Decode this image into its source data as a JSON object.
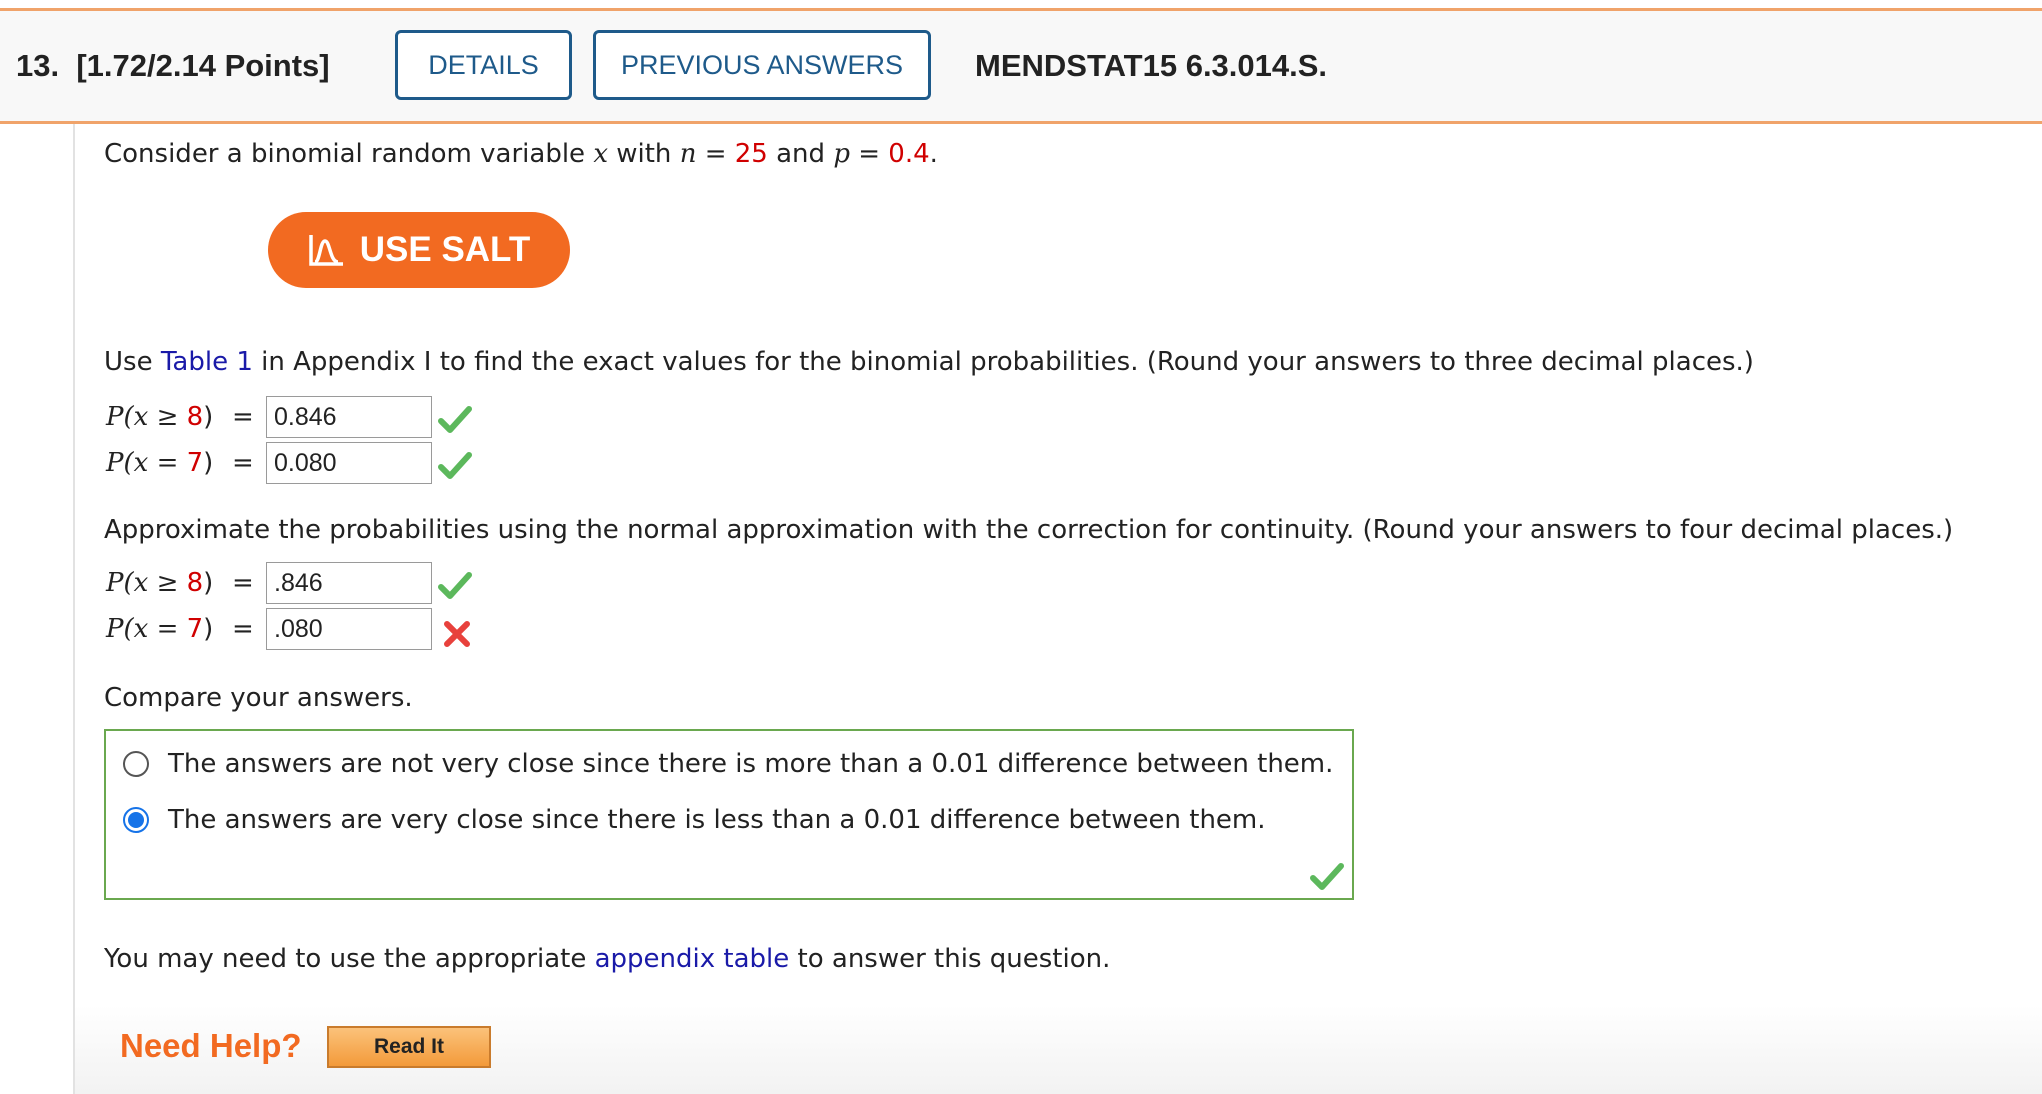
{
  "header": {
    "question_number": "13.",
    "points": "[1.72/2.14 Points]",
    "details_label": "DETAILS",
    "previous_answers_label": "PREVIOUS ANSWERS",
    "question_code": "MENDSTAT15 6.3.014.S."
  },
  "intro": {
    "prefix": "Consider a binomial random variable ",
    "var_x": "x",
    "with": " with ",
    "var_n": "n",
    "eq1": " = ",
    "n_value": "25",
    "and": " and ",
    "var_p": "p",
    "eq2": " = ",
    "p_value": "0.4",
    "period": "."
  },
  "salt_button": {
    "label": "USE SALT",
    "icon": "salt-graph-icon"
  },
  "part1": {
    "pre": "Use ",
    "link": "Table 1",
    "post": " in Appendix I to find the exact values for the binomial probabilities. (Round your answers to three decimal places.)",
    "rows": [
      {
        "lhs_pre": "P(x ≥ ",
        "num": "8",
        "lhs_post": ")",
        "eq": "=",
        "value": "0.846",
        "status": "correct"
      },
      {
        "lhs_pre": "P(x = ",
        "num": "7",
        "lhs_post": ")",
        "eq": "=",
        "value": "0.080",
        "status": "correct"
      }
    ]
  },
  "part2": {
    "instruction": "Approximate the probabilities using the normal approximation with the correction for continuity. (Round your answers to four decimal places.)",
    "rows": [
      {
        "lhs_pre": "P(x ≥ ",
        "num": "8",
        "lhs_post": ")",
        "eq": "=",
        "value": ".846",
        "status": "correct"
      },
      {
        "lhs_pre": "P(x = ",
        "num": "7",
        "lhs_post": ")",
        "eq": "=",
        "value": ".080",
        "status": "incorrect"
      }
    ]
  },
  "compare": {
    "prompt": "Compare your answers.",
    "options": [
      {
        "label": "The answers are not very close since there is more than a 0.01 difference between them.",
        "selected": false
      },
      {
        "label": "The answers are very close since there is less than a 0.01 difference between them.",
        "selected": true
      }
    ],
    "status": "correct"
  },
  "appendix_note": {
    "pre": "You may need to use the appropriate ",
    "link": "appendix table",
    "post": " to answer this question."
  },
  "help": {
    "label": "Need Help?",
    "read_it_label": "Read It"
  },
  "colors": {
    "accent_orange": "#f26a21",
    "header_rule": "#f0a36a",
    "button_blue": "#1e5a8a",
    "given_value_red": "#d00000",
    "link_blue": "#1a1aa8",
    "correct_green": "#5cb85c",
    "incorrect_red": "#e8413c",
    "radio_blue": "#1673e8"
  }
}
